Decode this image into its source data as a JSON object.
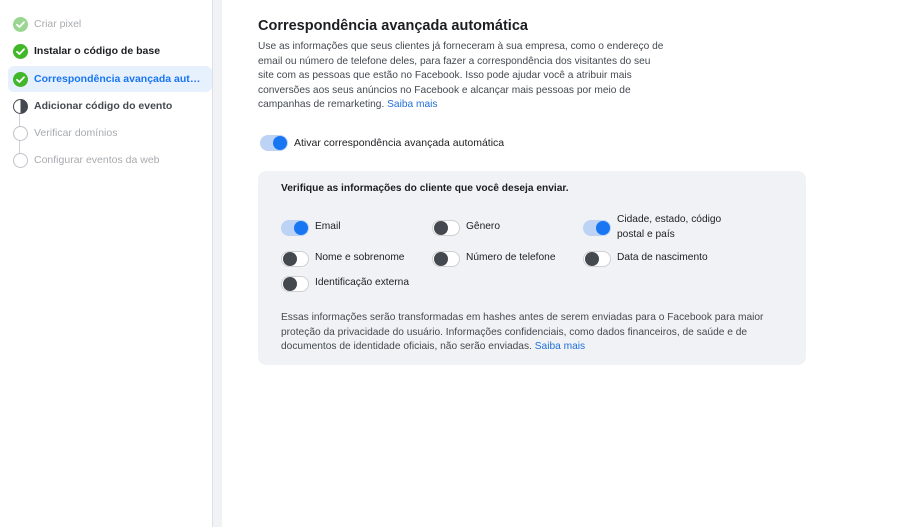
{
  "sidebar": {
    "steps": [
      {
        "label": "Criar pixel",
        "status": "done-faded"
      },
      {
        "label": "Instalar o código de base",
        "status": "done"
      },
      {
        "label": "Correspondência avançada automática",
        "status": "done-active"
      },
      {
        "label": "Adicionar código do evento",
        "status": "in-progress"
      },
      {
        "label": "Verificar domínios",
        "status": "pending"
      },
      {
        "label": "Configurar eventos da web",
        "status": "pending"
      }
    ]
  },
  "main": {
    "title": "Correspondência avançada automática",
    "description": "Use as informações que seus clientes já forneceram à sua empresa, como o endereço de email ou número de telefone deles, para fazer a correspondência dos visitantes do seu site com as pessoas que estão no Facebook. Isso pode ajudar você a atribuir mais conversões aos seus anúncios no Facebook e alcançar mais pessoas por meio de campanhas de remarketing.",
    "learn_more": "Saiba mais",
    "master_toggle": {
      "label": "Ativar correspondência avançada automática",
      "on": true
    },
    "panel": {
      "title": "Verifique as informações do cliente que você deseja enviar.",
      "options": [
        {
          "label": "Email",
          "on": true
        },
        {
          "label": "Gênero",
          "on": false
        },
        {
          "label": "Cidade, estado, código postal e país",
          "on": true
        },
        {
          "label": "Nome e sobrenome",
          "on": false
        },
        {
          "label": "Número de telefone",
          "on": false
        },
        {
          "label": "Data de nascimento",
          "on": false
        },
        {
          "label": "Identificação externa",
          "on": false
        }
      ],
      "note": "Essas informações serão transformadas em hashes antes de serem enviadas para o Facebook para maior proteção da privacidade do usuário. Informações confidenciais, como dados financeiros, de saúde e de documentos de identidade oficiais, não serão enviadas.",
      "learn_more": "Saiba mais"
    }
  },
  "colors": {
    "accent": "#1876f2",
    "success": "#42b72a",
    "panel_bg": "#f0f2f5",
    "active_bg": "#e7f0fd"
  }
}
